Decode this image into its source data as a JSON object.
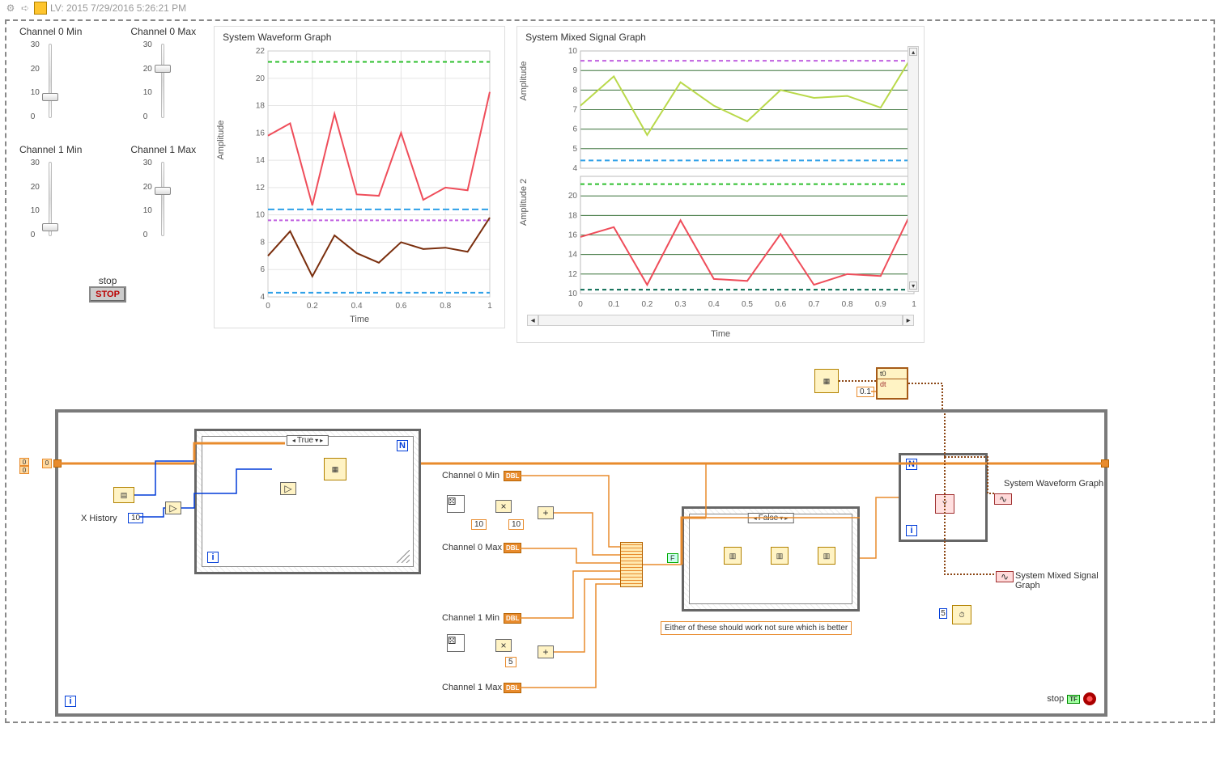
{
  "title": "LV: 2015 7/29/2016 5:26:21 PM",
  "sliders": {
    "ch0min": {
      "label": "Channel 0 Min",
      "scale": [
        "30",
        "20",
        "10",
        "0"
      ],
      "thumb_pct": 65
    },
    "ch0max": {
      "label": "Channel 0 Max",
      "scale": [
        "30",
        "20",
        "10",
        "0"
      ],
      "thumb_pct": 30
    },
    "ch1min": {
      "label": "Channel 1 Min",
      "scale": [
        "30",
        "20",
        "10",
        "0"
      ],
      "thumb_pct": 80
    },
    "ch1max": {
      "label": "Channel 1 Max",
      "scale": [
        "30",
        "20",
        "10",
        "0"
      ],
      "thumb_pct": 35
    }
  },
  "stop": {
    "label": "stop",
    "btn": "STOP"
  },
  "chart_data": [
    {
      "type": "line",
      "title": "System Waveform Graph",
      "xlabel": "Time",
      "ylabel": "Amplitude",
      "xlim": [
        0,
        1
      ],
      "ylim": [
        4,
        22
      ],
      "xticks": [
        0,
        0.2,
        0.4,
        0.6,
        0.8,
        1
      ],
      "yticks": [
        4,
        6,
        8,
        10,
        12,
        14,
        16,
        18,
        20,
        22
      ],
      "hlines": [
        {
          "y": 21.2,
          "color": "#2dbf2d",
          "dash": "5,4"
        },
        {
          "y": 10.4,
          "color": "#2ea0e8",
          "dash": "8,4"
        },
        {
          "y": 9.6,
          "color": "#c060e0",
          "dash": "4,3"
        },
        {
          "y": 4.3,
          "color": "#2ea0e8",
          "dash": "6,4"
        }
      ],
      "series": [
        {
          "name": "ch0",
          "color": "#ef4d5a",
          "width": 2,
          "x": [
            0,
            0.1,
            0.2,
            0.3,
            0.4,
            0.5,
            0.6,
            0.7,
            0.8,
            0.9,
            1
          ],
          "y": [
            15.8,
            16.7,
            10.7,
            17.4,
            11.5,
            11.4,
            16.0,
            11.1,
            12.0,
            11.8,
            19.0
          ]
        },
        {
          "name": "ch1",
          "color": "#7a2e0d",
          "width": 2,
          "x": [
            0,
            0.1,
            0.2,
            0.3,
            0.4,
            0.5,
            0.6,
            0.7,
            0.8,
            0.9,
            1
          ],
          "y": [
            7.0,
            8.8,
            5.5,
            8.5,
            7.2,
            6.5,
            8.0,
            7.5,
            7.6,
            7.3,
            9.8
          ]
        }
      ]
    },
    {
      "type": "mixed",
      "title": "System Mixed Signal Graph",
      "xlabel": "Time",
      "panels": [
        {
          "ylabel": "Amplitude",
          "ylim": [
            4,
            10
          ],
          "yticks": [
            4,
            5,
            6,
            7,
            8,
            9,
            10
          ],
          "hlines": [
            {
              "y": 9.5,
              "color": "#c060e0",
              "dash": "5,4"
            },
            {
              "y": 4.4,
              "color": "#2ea0e8",
              "dash": "6,4"
            }
          ],
          "series": [
            {
              "name": "s1",
              "color": "#b9d94a",
              "width": 2,
              "x": [
                0,
                0.1,
                0.2,
                0.3,
                0.4,
                0.5,
                0.6,
                0.7,
                0.8,
                0.9,
                1
              ],
              "y": [
                7.2,
                8.7,
                5.7,
                8.4,
                7.2,
                6.4,
                8.0,
                7.6,
                7.7,
                7.1,
                9.9
              ]
            }
          ]
        },
        {
          "ylabel": "Amplitude 2",
          "ylim": [
            10,
            22
          ],
          "yticks": [
            10,
            12,
            14,
            16,
            18,
            20
          ],
          "hlines": [
            {
              "y": 21.2,
              "color": "#2dbf2d",
              "dash": "5,4"
            },
            {
              "y": 10.4,
              "color": "#0a6b54",
              "dash": "5,4"
            }
          ],
          "series": [
            {
              "name": "s2",
              "color": "#ef4d5a",
              "width": 2,
              "x": [
                0,
                0.1,
                0.2,
                0.3,
                0.4,
                0.5,
                0.6,
                0.7,
                0.8,
                0.9,
                1
              ],
              "y": [
                15.8,
                16.8,
                10.9,
                17.5,
                11.5,
                11.3,
                16.1,
                10.9,
                12.0,
                11.8,
                18.9
              ]
            }
          ]
        }
      ],
      "xlim": [
        0,
        1
      ],
      "xticks": [
        0,
        0.1,
        0.2,
        0.3,
        0.4,
        0.5,
        0.6,
        0.7,
        0.8,
        0.9,
        1
      ]
    }
  ],
  "diagram": {
    "x_history": "X History",
    "x_history_val": "10",
    "const_10a": "10",
    "const_10b": "10",
    "const_5": "5",
    "const_01": "0.1",
    "const_t0": "t0",
    "const_dt": "dt",
    "sr_init": [
      "0",
      "0"
    ],
    "case_true": "True",
    "case_false": "False",
    "ch0min": "Channel 0 Min",
    "ch0max": "Channel 0 Max",
    "ch1min": "Channel 1 Min",
    "ch1max": "Channel 1 Max",
    "dbl": "DBL",
    "tf": "TF",
    "comment": "Either of these should work not sure which is better",
    "wf_graph_label": "System Waveform Graph",
    "mixed_graph_label": "System Mixed Signal Graph",
    "stop_label": "stop",
    "N": "N",
    "i": "i",
    "F": "F"
  }
}
